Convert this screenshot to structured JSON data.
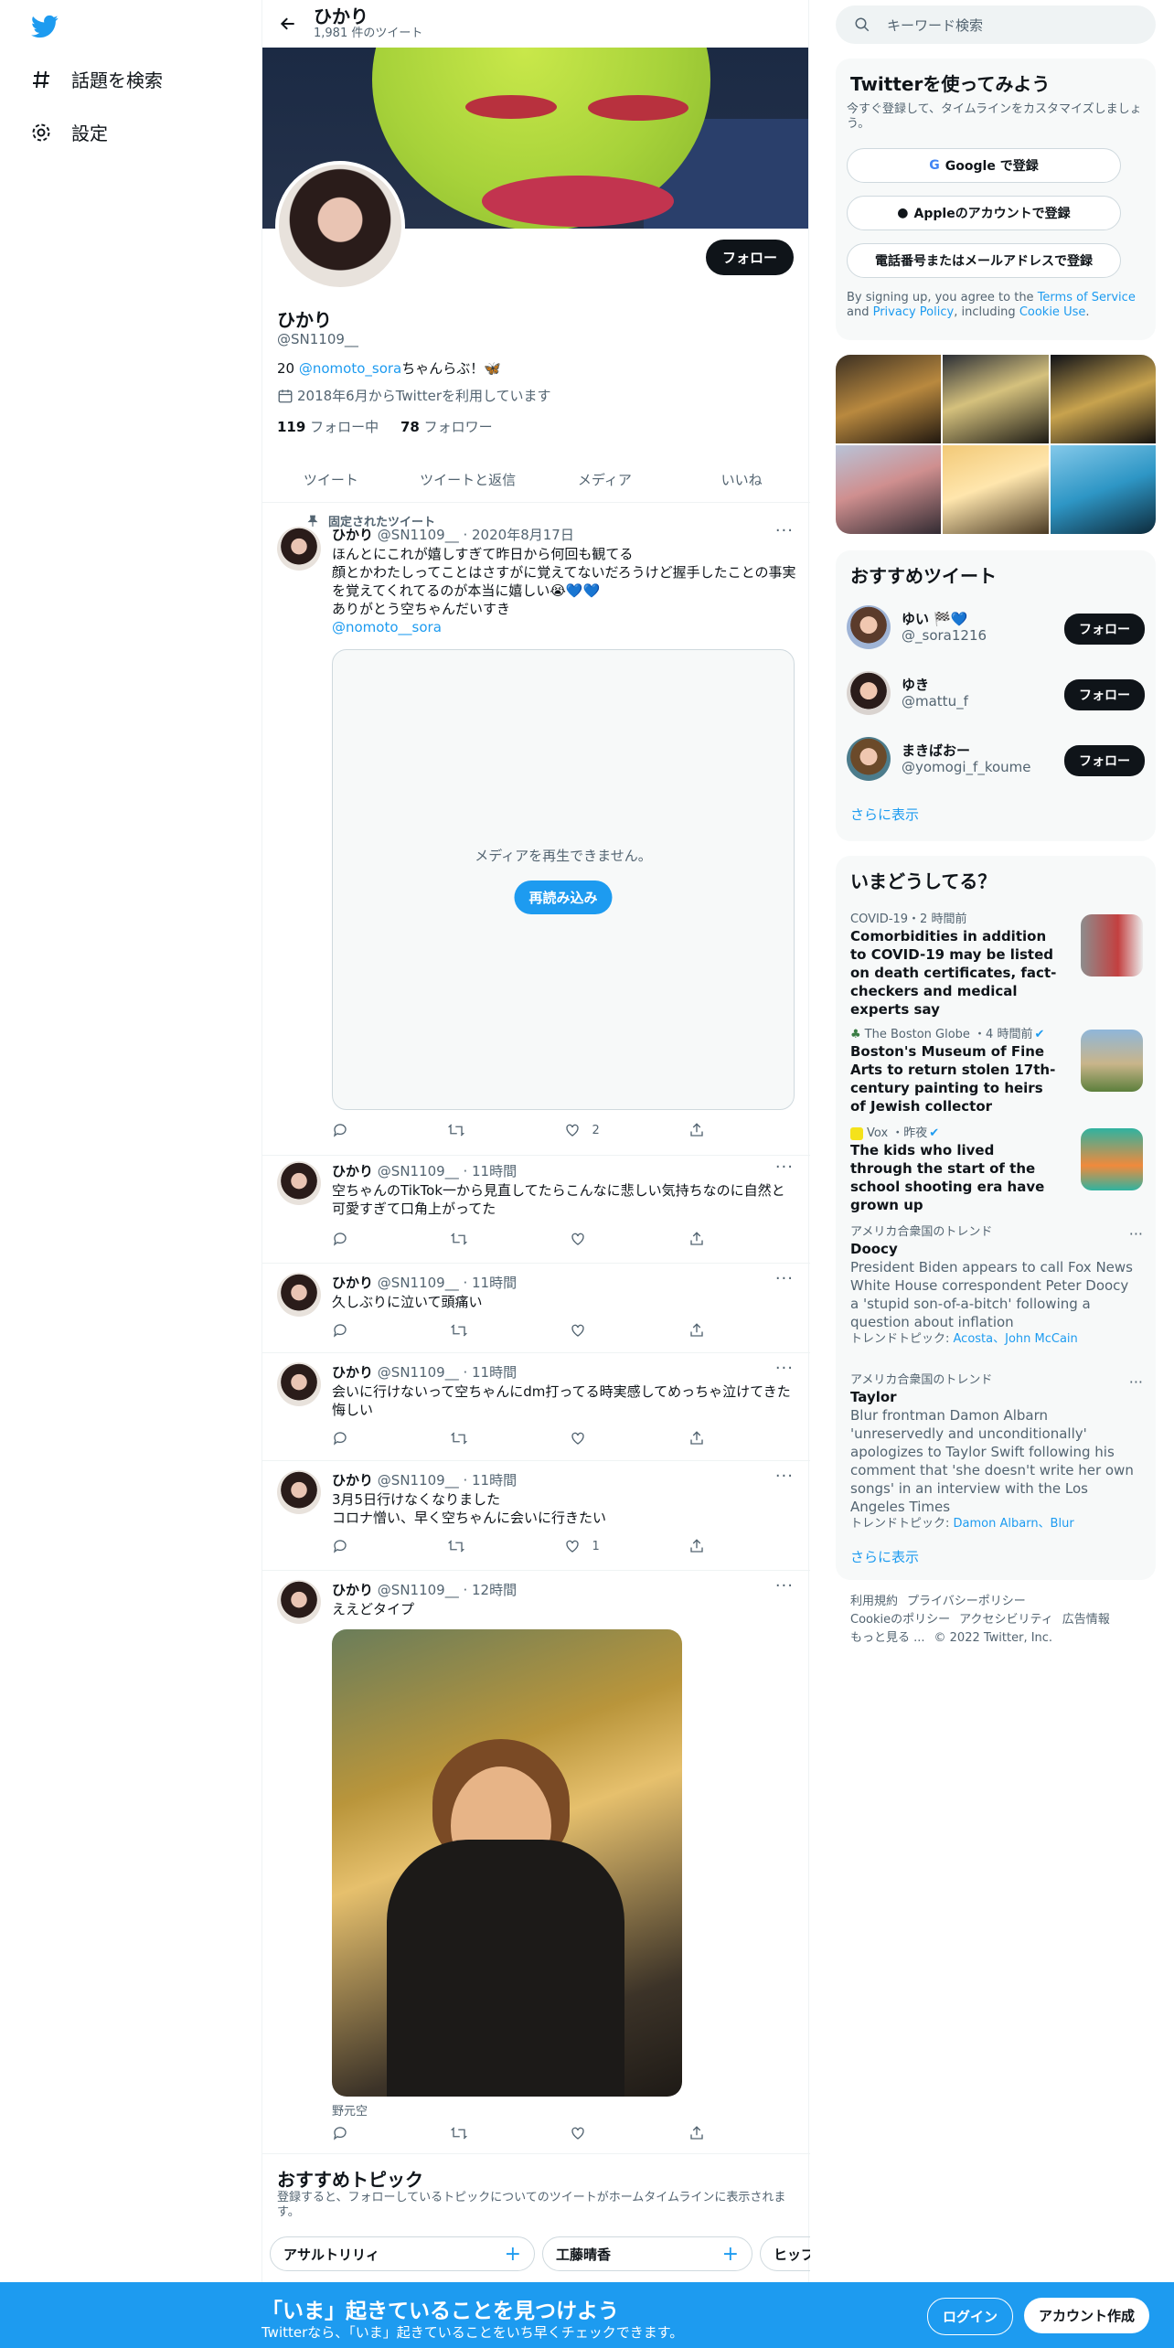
{
  "nav": {
    "explore": "話題を検索",
    "settings": "設定"
  },
  "header": {
    "name": "ひかり",
    "tweet_count": "1,981 件のツイート"
  },
  "profile": {
    "follow": "フォロー",
    "name": "ひかり",
    "handle": "@SN1109__",
    "bio_prefix": "20 ",
    "bio_mention": "@nomoto_sora",
    "bio_suffix": "ちゃんらぶ！🦋",
    "joined": "2018年6月からTwitterを利用しています",
    "following_count": "119",
    "following_label": " フォロー中",
    "followers_count": "78",
    "followers_label": " フォロワー"
  },
  "tabs": [
    "ツイート",
    "ツイートと返信",
    "メディア",
    "いいね"
  ],
  "tweets": [
    {
      "pinned": "固定されたツイート",
      "name": "ひかり",
      "meta": "@SN1109__ · 2020年8月17日",
      "text": "ほんとにこれが嬉しすぎて昨日から何回も観てる\n顔とかわたしってことはさすがに覚えてないだろうけど握手したことの事実を覚えてくれてるのが本当に嬉しい😭💙💙\nありがとう空ちゃんだいすき",
      "mention": "@nomoto__sora",
      "media_msg": "メディアを再生できません。",
      "reload": "再読み込み",
      "likes": "2"
    },
    {
      "name": "ひかり",
      "meta": "@SN1109__ · 11時間",
      "text": "空ちゃんのTikTok一から見直してたらこんなに悲しい気持ちなのに自然と可愛すぎて口角上がってた",
      "likes": ""
    },
    {
      "name": "ひかり",
      "meta": "@SN1109__ · 11時間",
      "text": "久しぶりに泣いて頭痛い",
      "likes": ""
    },
    {
      "name": "ひかり",
      "meta": "@SN1109__ · 11時間",
      "text": "会いに行けないって空ちゃんにdm打ってる時実感してめっちゃ泣けてきた悔しい",
      "likes": ""
    },
    {
      "name": "ひかり",
      "meta": "@SN1109__ · 11時間",
      "text": "3月5日行けなくなりました\nコロナ憎い、早く空ちゃんに会いに行きたい",
      "likes": "1"
    },
    {
      "name": "ひかり",
      "meta": "@SN1109__ · 12時間",
      "text": "ええどタイプ",
      "caption": "野元空",
      "likes": ""
    }
  ],
  "topics": {
    "title": "おすすめトピック",
    "desc": "登録すると、フォローしているトピックについてのツイートがホームタイムラインに表示されます。",
    "chips": [
      "アサルトリリィ",
      "工藤晴香",
      "ヒップ"
    ]
  },
  "right": {
    "search_placeholder": "キーワード検索",
    "signup": {
      "title": "Twitterを使ってみよう",
      "desc": "今すぐ登録して、タイムラインをカスタマイズしましょう。",
      "google": "Google で登録",
      "apple": "Appleのアカウントで登録",
      "phone": "電話番号またはメールアドレスで登録",
      "legal_1": "By signing up, you agree to the ",
      "terms": "Terms of Service",
      "legal_2": " and ",
      "privacy": "Privacy Policy",
      "legal_3": ", including ",
      "cookie": "Cookie Use",
      "legal_4": "."
    },
    "recommend": {
      "title": "おすすめツイート",
      "users": [
        {
          "name": "ゆい 🏁💙",
          "handle": "@_sora1216",
          "follow": "フォロー"
        },
        {
          "name": "ゆき",
          "handle": "@mattu_f",
          "follow": "フォロー"
        },
        {
          "name": "まきばおー",
          "handle": "@yomogi_f_koume",
          "follow": "フォロー"
        }
      ],
      "more": "さらに表示"
    },
    "trends": {
      "title": "いまどうしてる？",
      "items": [
        {
          "meta": "COVID-19・2 時間前",
          "headline": "Comorbidities in addition to COVID-19 may be listed on death certificates, fact-checkers and medical experts say"
        },
        {
          "meta": "The Boston Globe ・4 時間前",
          "headline": "Boston's Museum of Fine Arts to return stolen 17th-century painting to heirs of Jewish collector"
        },
        {
          "meta": "Vox ・昨夜",
          "headline": "The kids who lived through the start of the school shooting era have grown up"
        },
        {
          "meta": "アメリカ合衆国のトレンド",
          "topic": "Doocy",
          "desc": "President Biden appears to call Fox News White House correspondent Peter Doocy a 'stupid son-of-a-bitch' following a question about inflation",
          "related_label": "トレンドトピック: ",
          "related": "Acosta、John McCain"
        },
        {
          "meta": "アメリカ合衆国のトレンド",
          "topic": "Taylor",
          "desc": "Blur frontman Damon Albarn 'unreservedly and unconditionally' apologizes to Taylor Swift following his comment that 'she doesn't write her own songs' in an interview with the Los Angeles Times",
          "related_label": "トレンドトピック: ",
          "related": "Damon Albarn、Blur"
        }
      ],
      "more": "さらに表示"
    },
    "footer": {
      "terms": "利用規約",
      "privacy": "プライバシーポリシー",
      "cookie": "Cookieのポリシー",
      "accessibility": "アクセシビリティ",
      "ads": "広告情報",
      "more": "もっと見る ...",
      "copyright": "© 2022 Twitter, Inc."
    }
  },
  "bottom": {
    "title": "「いま」起きていることを見つけよう",
    "subtitle": "Twitterなら、「いま」起きていることをいち早くチェックできます。",
    "login": "ログイン",
    "signup": "アカウント作成"
  },
  "colors": {
    "accent": "#1d9bf0",
    "text": "#0f1419",
    "muted": "#536471"
  }
}
